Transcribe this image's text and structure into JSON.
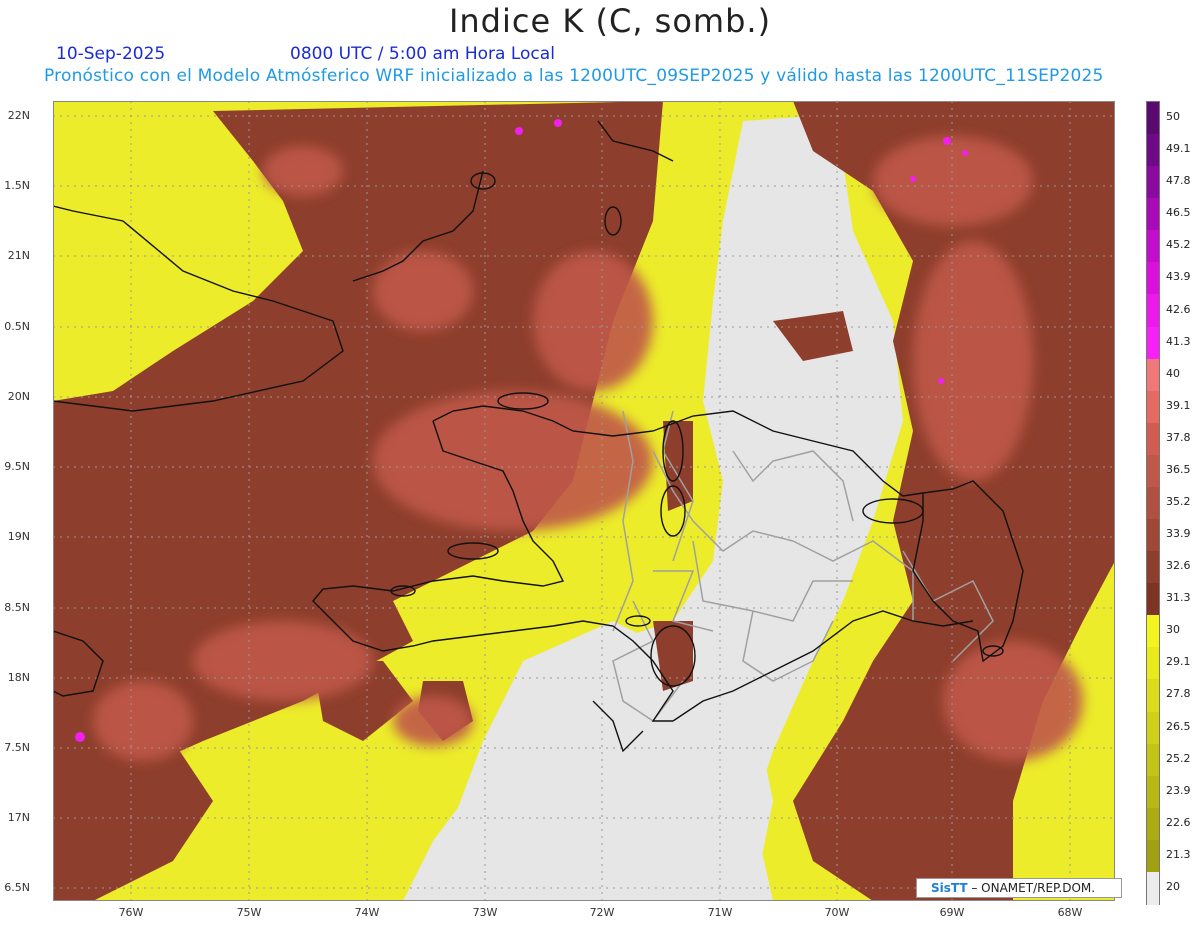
{
  "header": {
    "title": "Indice K (C, somb.)",
    "date": "10-Sep-2025",
    "valid_time": "0800 UTC / 5:00 am Hora Local",
    "description": "Pronóstico con el Modelo Atmósferico WRF inicializado a las 1200UTC_09SEP2025 y válido hasta las  1200UTC_11SEP2025"
  },
  "axes": {
    "lat_labels": [
      "22N",
      "1.5N",
      "21N",
      "0.5N",
      "20N",
      "9.5N",
      "19N",
      "8.5N",
      "18N",
      "7.5N",
      "17N",
      "6.5N"
    ],
    "lon_labels": [
      "76W",
      "75W",
      "74W",
      "73W",
      "72W",
      "71W",
      "70W",
      "69W",
      "68W"
    ]
  },
  "colorbar": {
    "labels": [
      "50",
      "49.1",
      "47.8",
      "46.5",
      "45.2",
      "43.9",
      "42.6",
      "41.3",
      "40",
      "39.1",
      "37.8",
      "36.5",
      "35.2",
      "33.9",
      "32.6",
      "31.3",
      "30",
      "29.1",
      "27.8",
      "26.5",
      "25.2",
      "23.9",
      "22.6",
      "21.3",
      "20"
    ],
    "colors": [
      "#5a0a6e",
      "#6e0a86",
      "#8a0aa0",
      "#a80ab8",
      "#c40ccc",
      "#dc10dc",
      "#ec18ec",
      "#f820f8",
      "#f07878",
      "#e46a62",
      "#d05c52",
      "#c0584a",
      "#b05040",
      "#a04836",
      "#8e3e2c",
      "#7e3422",
      "#f4f41e",
      "#e8ea1c",
      "#dcdc1a",
      "#d0d018",
      "#c4c416",
      "#b8b814",
      "#acac12",
      "#a0a010",
      "#ececec"
    ]
  },
  "credit": {
    "brand": "SisTT",
    "org": " – ONAMET/REP.DOM."
  },
  "colors": {
    "high_k": "#8e3e2c",
    "mid_k": "#c0584a",
    "low_k": "#ecec2a",
    "none": "#e6e6e6",
    "coast": "#111111",
    "borders": "#a0a0a0"
  }
}
